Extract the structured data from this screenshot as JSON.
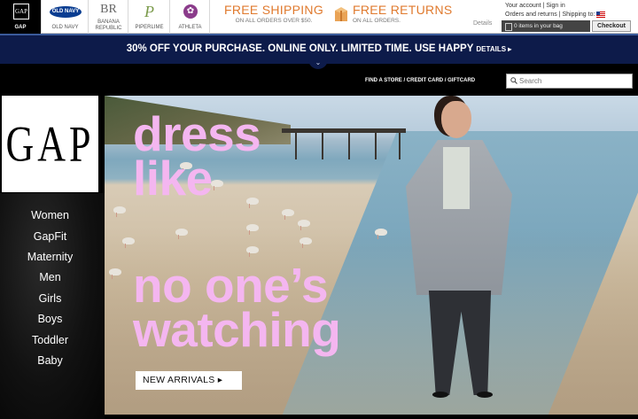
{
  "brands": [
    {
      "id": "gap",
      "label": "GAP"
    },
    {
      "id": "oldnavy",
      "label": "OLD NAVY",
      "logo_text": "OLD NAVY"
    },
    {
      "id": "br",
      "label": "BANANA REPUBLIC",
      "logo_text": "BR"
    },
    {
      "id": "piperlime",
      "label": "PIPERLIME",
      "logo_text": "P"
    },
    {
      "id": "athleta",
      "label": "ATHLETA",
      "logo_text": "✿"
    }
  ],
  "gap_mini_logo": "GAP",
  "promos": {
    "shipping_big": "FREE SHIPPING",
    "shipping_small": "ON ALL ORDERS OVER $50.",
    "returns_big": "FREE RETURNS",
    "returns_small": "ON ALL ORDERS.",
    "details": "Details"
  },
  "account": {
    "line1": "Your account | Sign in",
    "line2": "Orders and returns | Shipping to:",
    "bag_text": "0 items in your bag",
    "checkout": "Checkout"
  },
  "banner": {
    "text": "30% OFF YOUR PURCHASE. ONLINE ONLY. LIMITED TIME. USE ",
    "code": "HAPPY",
    "details": "DETAILS ▸",
    "chevron": "⌄"
  },
  "utility_links": "FIND A STORE / CREDIT CARD / GIFTCARD",
  "search": {
    "placeholder": "Search"
  },
  "logo_text": "GAP",
  "nav": [
    "Women",
    "GapFit",
    "Maternity",
    "Men",
    "Girls",
    "Boys",
    "Toddler",
    "Baby"
  ],
  "hero": {
    "headline": [
      "dress",
      "like",
      "no one’s",
      "watching"
    ],
    "cta": "NEW ARRIVALS ▸"
  },
  "colors": {
    "accent_orange": "#e07a2e",
    "banner_navy": "#0d1b4a",
    "headline_pink": "#f4b6f0"
  }
}
